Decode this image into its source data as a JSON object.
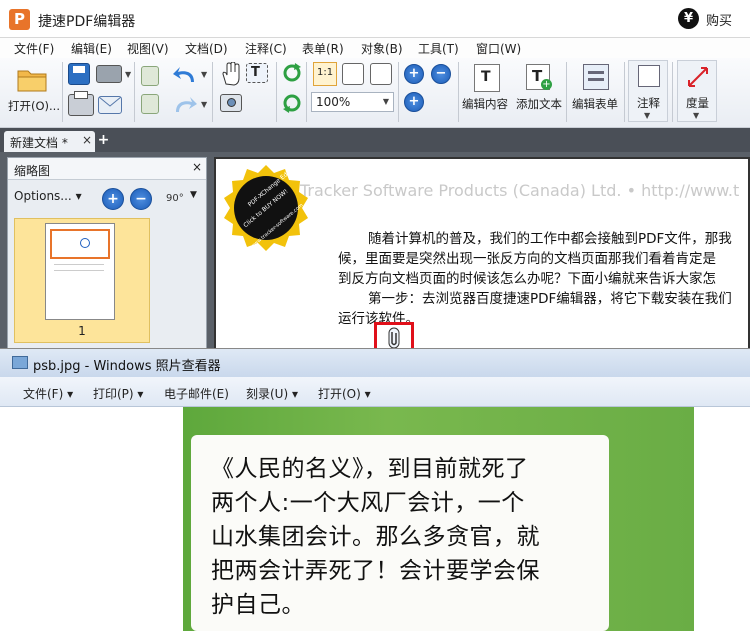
{
  "app": {
    "logo_letter": "P",
    "title": "捷速PDF编辑器",
    "buy_icon": "¥",
    "buy_label": "购买"
  },
  "menu": [
    "文件(F)",
    "编辑(E)",
    "视图(V)",
    "文档(D)",
    "注释(C)",
    "表单(R)",
    "对象(B)",
    "工具(T)",
    "窗口(W)"
  ],
  "toolbar": {
    "open_label": "打开(O)...",
    "zoom_value": "100%",
    "edit_content": "编辑内容",
    "add_text": "添加文本",
    "edit_form": "编辑表单",
    "annotate": "注释",
    "measure": "度量",
    "actual_size": "1:1"
  },
  "tabs": {
    "doc_tab": "新建文档 *",
    "close": "×",
    "add": "+"
  },
  "thumbnails": {
    "title": "缩略图",
    "close": "×",
    "options": "Options...",
    "rotate": "90°",
    "page_number": "1"
  },
  "document": {
    "watermark": "Tracker Software Products (Canada) Ltd. • http://www.t",
    "paragraphs": [
      "随着计算机的普及，我们的工作中都会接触到PDF文件，那我",
      "候，里面要是突然出现一张反方向的文档页面那我们看着肯定是",
      "到反方向文档页面的时候该怎么办呢？下面小编就来告诉大家怎",
      "第一步：去浏览器百度捷速PDF编辑器，将它下载安装在我们",
      "运行该软件。"
    ],
    "stamp_text": "PDF-XChange Editor",
    "stamp_sub": "Click to BUY NOW!",
    "stamp_url": "www.tracker-software.com"
  },
  "viewer": {
    "title": "psb.jpg - Windows 照片查看器",
    "menu": [
      "文件(F) ▾",
      "打印(P) ▾",
      "电子邮件(E)",
      "刻录(U) ▾",
      "打开(O) ▾"
    ],
    "photo_lines": [
      "《人民的名义》，到目前就死了",
      "两个人:一个大风厂会计，一个",
      "山水集团会计。那么多贪官，就",
      "把两会计弄死了！会计要学会保",
      "护自己。"
    ]
  }
}
